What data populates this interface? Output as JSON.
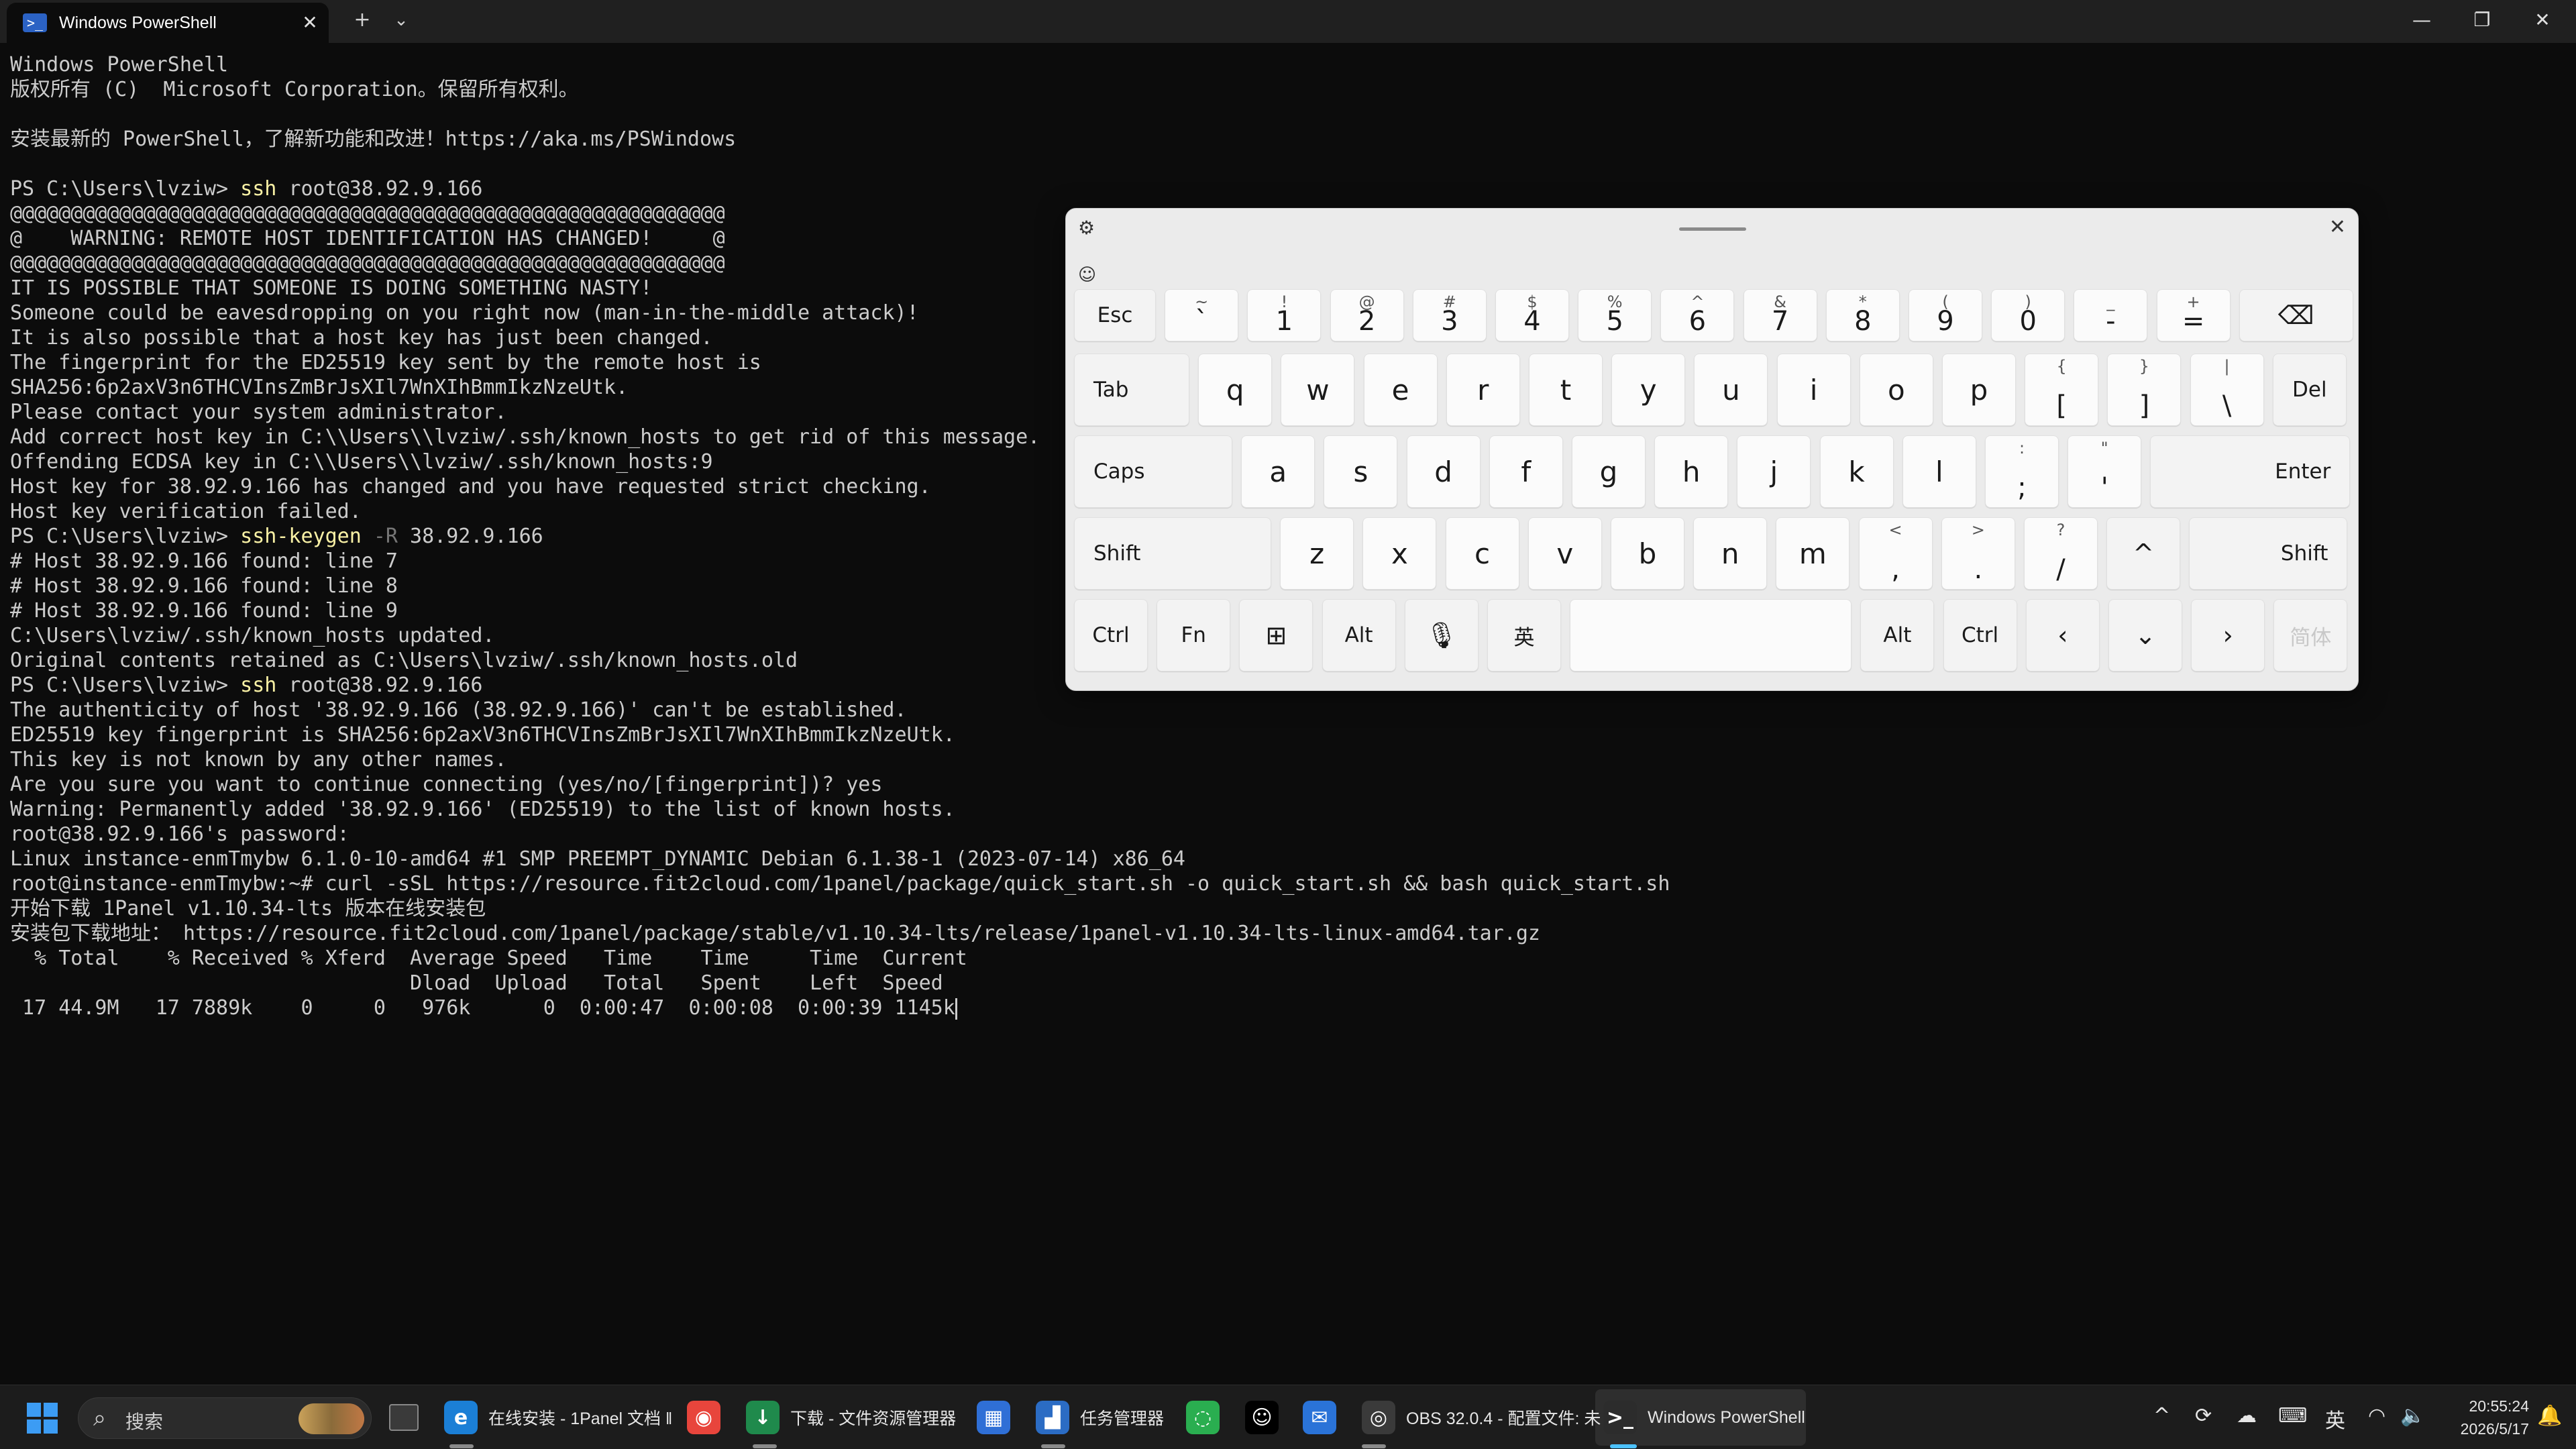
{
  "window": {
    "tab_title": "Windows PowerShell",
    "tab_icon": "powershell-icon",
    "new_tab_label": "+",
    "dropdown_label": "⌄",
    "minimize_label": "—",
    "maximize_label": "❐",
    "close_label": "✕"
  },
  "terminal": {
    "lines": [
      "Windows PowerShell",
      "版权所有 (C)  Microsoft Corporation。保留所有权利。",
      "",
      "安装最新的 PowerShell，了解新功能和改进！https://aka.ms/PSWindows",
      "",
      "PS C:\\Users\\lvziw> ssh root@38.92.9.166",
      "@@@@@@@@@@@@@@@@@@@@@@@@@@@@@@@@@@@@@@@@@@@@@@@@@@@@@@@@@@@",
      "@    WARNING: REMOTE HOST IDENTIFICATION HAS CHANGED!     @",
      "@@@@@@@@@@@@@@@@@@@@@@@@@@@@@@@@@@@@@@@@@@@@@@@@@@@@@@@@@@@",
      "IT IS POSSIBLE THAT SOMEONE IS DOING SOMETHING NASTY!",
      "Someone could be eavesdropping on you right now (man-in-the-middle attack)!",
      "It is also possible that a host key has just been changed.",
      "The fingerprint for the ED25519 key sent by the remote host is",
      "SHA256:6p2axV3n6THCVInsZmBrJsXIl7WnXIhBmmIkzNzeUtk.",
      "Please contact your system administrator.",
      "Add correct host key in C:\\\\Users\\\\lvziw/.ssh/known_hosts to get rid of this message.",
      "Offending ECDSA key in C:\\\\Users\\\\lvziw/.ssh/known_hosts:9",
      "Host key for 38.92.9.166 has changed and you have requested strict checking.",
      "Host key verification failed.",
      "PS C:\\Users\\lvziw> ssh-keygen -R 38.92.9.166",
      "# Host 38.92.9.166 found: line 7",
      "# Host 38.92.9.166 found: line 8",
      "# Host 38.92.9.166 found: line 9",
      "C:\\Users\\lvziw/.ssh/known_hosts updated.",
      "Original contents retained as C:\\Users\\lvziw/.ssh/known_hosts.old",
      "PS C:\\Users\\lvziw> ssh root@38.92.9.166",
      "The authenticity of host '38.92.9.166 (38.92.9.166)' can't be established.",
      "ED25519 key fingerprint is SHA256:6p2axV3n6THCVInsZmBrJsXIl7WnXIhBmmIkzNzeUtk.",
      "This key is not known by any other names.",
      "Are you sure you want to continue connecting (yes/no/[fingerprint])? yes",
      "Warning: Permanently added '38.92.9.166' (ED25519) to the list of known hosts.",
      "root@38.92.9.166's password:",
      "Linux instance-enmTmybw 6.1.0-10-amd64 #1 SMP PREEMPT_DYNAMIC Debian 6.1.38-1 (2023-07-14) x86_64",
      "root@instance-enmTmybw:~# curl -sSL https://resource.fit2cloud.com/1panel/package/quick_start.sh -o quick_start.sh && bash quick_start.sh",
      "开始下载 1Panel v1.10.34-lts 版本在线安装包",
      "安装包下载地址： https://resource.fit2cloud.com/1panel/package/stable/v1.10.34-lts/release/1panel-v1.10.34-lts-linux-amd64.tar.gz",
      "  % Total    % Received % Xferd  Average Speed   Time    Time     Time  Current",
      "                                 Dload  Upload   Total   Spent    Left  Speed",
      " 17 44.9M   17 7889k    0     0   976k      0  0:00:47  0:00:08  0:00:39 1145k"
    ],
    "prompt_lines": [
      {
        "line": 5,
        "prompt": "PS C:\\Users\\lvziw> ",
        "cmd": "ssh",
        "flag": "",
        "rest": " root@38.92.9.166"
      },
      {
        "line": 19,
        "prompt": "PS C:\\Users\\lvziw> ",
        "cmd": "ssh-keygen",
        "flag": " -R",
        "rest": " 38.92.9.166"
      },
      {
        "line": 25,
        "prompt": "PS C:\\Users\\lvziw> ",
        "cmd": "ssh",
        "flag": "",
        "rest": " root@38.92.9.166"
      }
    ]
  },
  "keyboard": {
    "settings_icon": "gear-icon",
    "emoji_icon": "emoji-icon",
    "close_label": "✕",
    "rows": [
      [
        {
          "main": "Esc",
          "type": "func"
        },
        {
          "sub": "~",
          "main": "`"
        },
        {
          "sub": "!",
          "main": "1"
        },
        {
          "sub": "@",
          "main": "2"
        },
        {
          "sub": "#",
          "main": "3"
        },
        {
          "sub": "$",
          "main": "4"
        },
        {
          "sub": "%",
          "main": "5"
        },
        {
          "sub": "^",
          "main": "6"
        },
        {
          "sub": "&",
          "main": "7"
        },
        {
          "sub": "*",
          "main": "8"
        },
        {
          "sub": "(",
          "main": "9"
        },
        {
          "sub": ")",
          "main": "0"
        },
        {
          "sub": "_",
          "main": "-"
        },
        {
          "sub": "+",
          "main": "="
        },
        {
          "main": "⌫",
          "type": "func",
          "name": "backspace-icon"
        }
      ],
      [
        {
          "main": "Tab",
          "type": "func",
          "align": "left"
        },
        {
          "main": "q"
        },
        {
          "main": "w"
        },
        {
          "main": "e"
        },
        {
          "main": "r"
        },
        {
          "main": "t"
        },
        {
          "main": "y"
        },
        {
          "main": "u"
        },
        {
          "main": "i"
        },
        {
          "main": "o"
        },
        {
          "main": "p"
        },
        {
          "sub": "{",
          "main": "["
        },
        {
          "sub": "}",
          "main": "]"
        },
        {
          "sub": "|",
          "main": "\\"
        },
        {
          "main": "Del",
          "type": "func"
        }
      ],
      [
        {
          "main": "Caps",
          "type": "func",
          "align": "left"
        },
        {
          "main": "a"
        },
        {
          "main": "s"
        },
        {
          "main": "d"
        },
        {
          "main": "f"
        },
        {
          "main": "g"
        },
        {
          "main": "h"
        },
        {
          "main": "j"
        },
        {
          "main": "k"
        },
        {
          "main": "l"
        },
        {
          "sub": ":",
          "main": ";"
        },
        {
          "sub": "\"",
          "main": "'"
        },
        {
          "main": "Enter",
          "type": "func",
          "align": "right"
        }
      ],
      [
        {
          "main": "Shift",
          "type": "func",
          "align": "left"
        },
        {
          "main": "z"
        },
        {
          "main": "x"
        },
        {
          "main": "c"
        },
        {
          "main": "v"
        },
        {
          "main": "b"
        },
        {
          "main": "n"
        },
        {
          "main": "m"
        },
        {
          "sub": "<",
          "main": ","
        },
        {
          "sub": ">",
          "main": "."
        },
        {
          "sub": "?",
          "main": "/"
        },
        {
          "main": "^",
          "type": "func",
          "name": "arrow-up-icon"
        },
        {
          "main": "Shift",
          "type": "func",
          "align": "right"
        }
      ],
      [
        {
          "main": "Ctrl",
          "type": "func"
        },
        {
          "main": "Fn",
          "type": "func"
        },
        {
          "main": "⊞",
          "type": "func",
          "name": "windows-icon"
        },
        {
          "main": "Alt",
          "type": "func"
        },
        {
          "main": "🎙",
          "type": "func",
          "name": "microphone-icon"
        },
        {
          "main": "英",
          "type": "func"
        },
        {
          "main": "",
          "type": "space"
        },
        {
          "main": "Alt",
          "type": "func"
        },
        {
          "main": "Ctrl",
          "type": "func"
        },
        {
          "main": "‹",
          "type": "func",
          "name": "arrow-left-icon"
        },
        {
          "main": "⌄",
          "type": "func",
          "name": "arrow-down-icon"
        },
        {
          "main": "›",
          "type": "func",
          "name": "arrow-right-icon"
        },
        {
          "main": "简体",
          "type": "disabled"
        }
      ]
    ]
  },
  "taskbar": {
    "start_icon": "windows-start-icon",
    "search_placeholder": "搜索",
    "apps": [
      {
        "icon": "edge-icon",
        "label": "在线安装 - 1Panel 文档 ‖"
      },
      {
        "icon": "chrome-icon",
        "label": ""
      },
      {
        "icon": "file-explorer-icon",
        "label": "下载 - 文件资源管理器"
      },
      {
        "icon": "store-icon",
        "label": ""
      },
      {
        "icon": "task-manager-icon",
        "label": "任务管理器"
      },
      {
        "icon": "wechat-icon",
        "label": ""
      },
      {
        "icon": "qq-icon",
        "label": ""
      },
      {
        "icon": "mail-icon",
        "label": ""
      },
      {
        "icon": "obs-icon",
        "label": "OBS 32.0.4 - 配置文件: 未"
      },
      {
        "icon": "terminal-icon",
        "label": "Windows PowerShell"
      }
    ],
    "tray": {
      "chevron": "^",
      "ime": "英",
      "time": "20:55:24",
      "date": "2026/5/17"
    }
  }
}
